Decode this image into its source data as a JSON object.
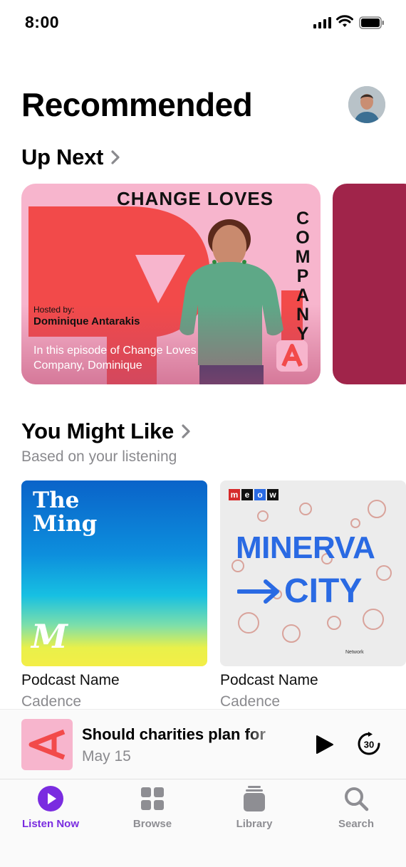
{
  "status": {
    "time": "8:00"
  },
  "header": {
    "title": "Recommended"
  },
  "up_next": {
    "title": "Up Next",
    "card": {
      "show_title": "CHANGE LOVES",
      "vertical_word": [
        "C",
        "O",
        "M",
        "P",
        "A",
        "N",
        "Y"
      ],
      "hosted_by": "Hosted by:",
      "host": "Dominique Antarakis",
      "episode_text": "In this episode of Change Loves Company, Dominique",
      "badge_letter": "A"
    }
  },
  "you_might_like": {
    "title": "You Might Like",
    "subtitle": "Based on your listening",
    "items": [
      {
        "art_title_line1": "The",
        "art_title_line2": "Ming",
        "art_mark": "M",
        "name": "Podcast Name",
        "cadence": "Cadence"
      },
      {
        "logo": [
          "m",
          "e",
          "o",
          "w"
        ],
        "art_title_line1": "MINERVA",
        "art_title_line2": "CITY",
        "network": "Network",
        "name": "Podcast Name",
        "cadence": "Cadence"
      }
    ]
  },
  "player": {
    "title": "Should charities plan for",
    "date": "May 15",
    "skip_seconds": "30",
    "art_letter": "A"
  },
  "tabs": [
    {
      "label": "Listen Now",
      "icon": "play-circle-icon",
      "active": true
    },
    {
      "label": "Browse",
      "icon": "grid-icon",
      "active": false
    },
    {
      "label": "Library",
      "icon": "library-stack-icon",
      "active": false
    },
    {
      "label": "Search",
      "icon": "search-icon",
      "active": false
    }
  ],
  "colors": {
    "accent": "#7a2ce0",
    "card_pink": "#f7b5cd",
    "card_red": "#f24a4a",
    "minerva_blue": "#2a6ae3"
  }
}
